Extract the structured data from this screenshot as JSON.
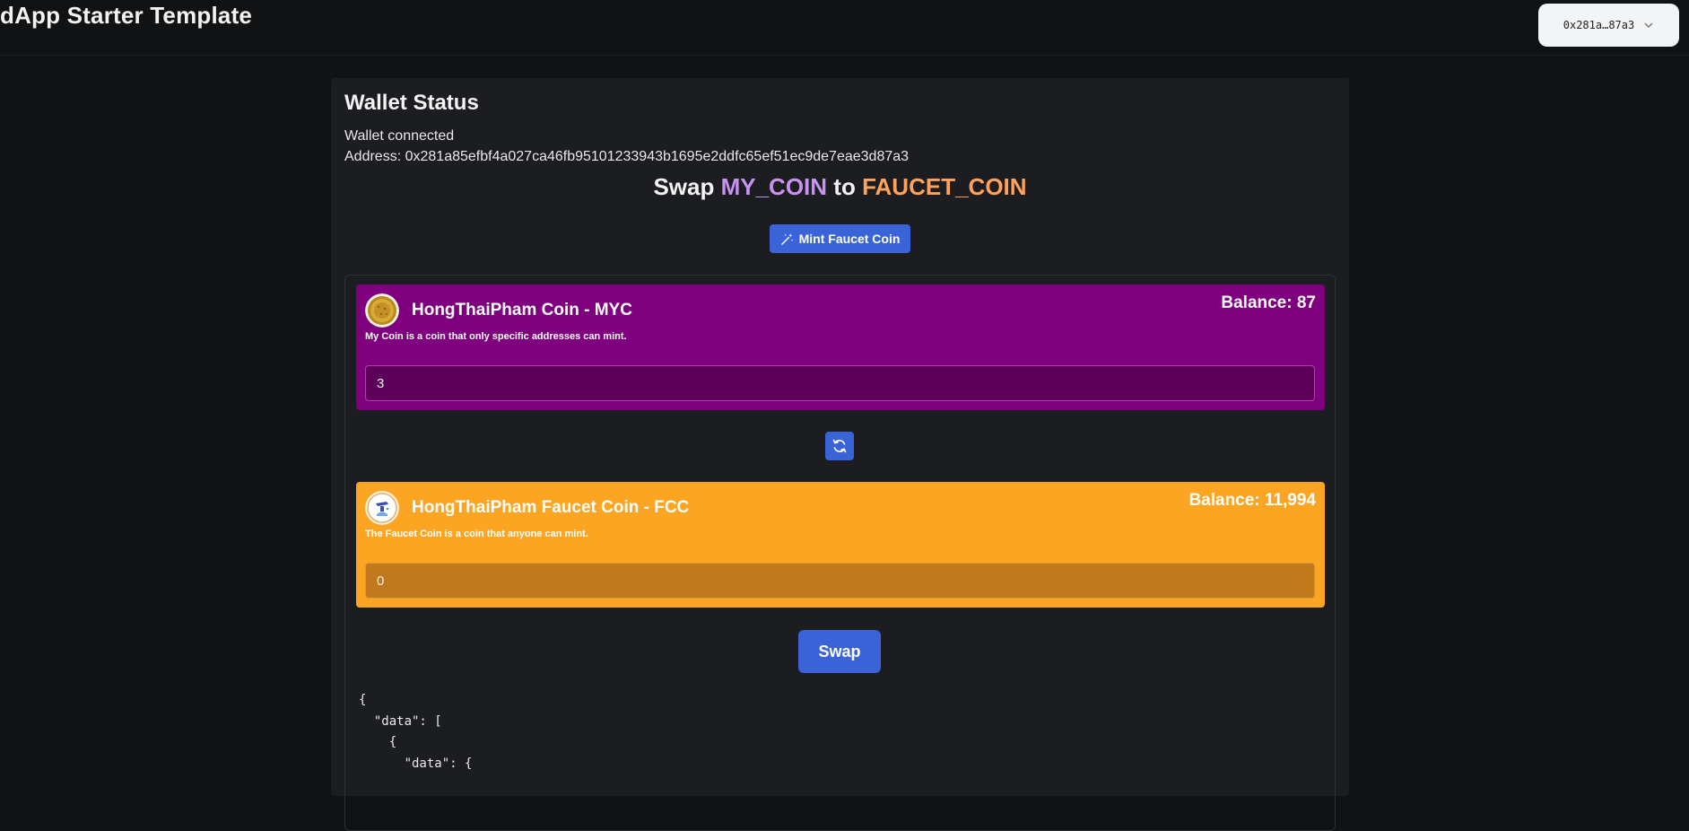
{
  "header": {
    "title": "dApp Starter Template",
    "wallet_label": "0x281a…87a3"
  },
  "wallet_status": {
    "title": "Wallet Status",
    "status": "Wallet connected",
    "address_label": "Address:",
    "address": "0x281a85efbf4a027ca46fb95101233943b1695e2ddfc65ef51ec9de7eae3d87a3"
  },
  "swap": {
    "heading_prefix": "Swap",
    "from_token": "MY_COIN",
    "heading_mid": "to",
    "to_token": "FAUCET_COIN",
    "mint_button": "Mint Faucet Coin",
    "swap_button": "Swap",
    "from_coin": {
      "name": "HongThaiPham Coin - MYC",
      "description": "My Coin is a coin that only specific addresses can mint.",
      "balance_label": "Balance:",
      "balance": "87",
      "input_value": "3"
    },
    "to_coin": {
      "name": "HongThaiPham Faucet Coin - FCC",
      "description": "The Faucet Coin is a coin that anyone can mint.",
      "balance_label": "Balance:",
      "balance": "11,994",
      "input_value": "0"
    }
  },
  "output": {
    "json_text": "{\n  \"data\": [\n    {\n      \"data\": {"
  },
  "colors": {
    "accent": "#3b63d8",
    "my_coin_bg": "#7f007f",
    "faucet_coin_bg": "#fca523",
    "from_token_text": "#c792f0",
    "to_token_text": "#ffa35c"
  },
  "icons": {
    "wallet_chevron": "chevron-down-icon",
    "mint": "magic-wand-icon",
    "flip": "refresh-arrows-icon",
    "my_coin_logo": "gold-coin-icon",
    "faucet_coin_logo": "faucet-coin-logo-icon"
  }
}
